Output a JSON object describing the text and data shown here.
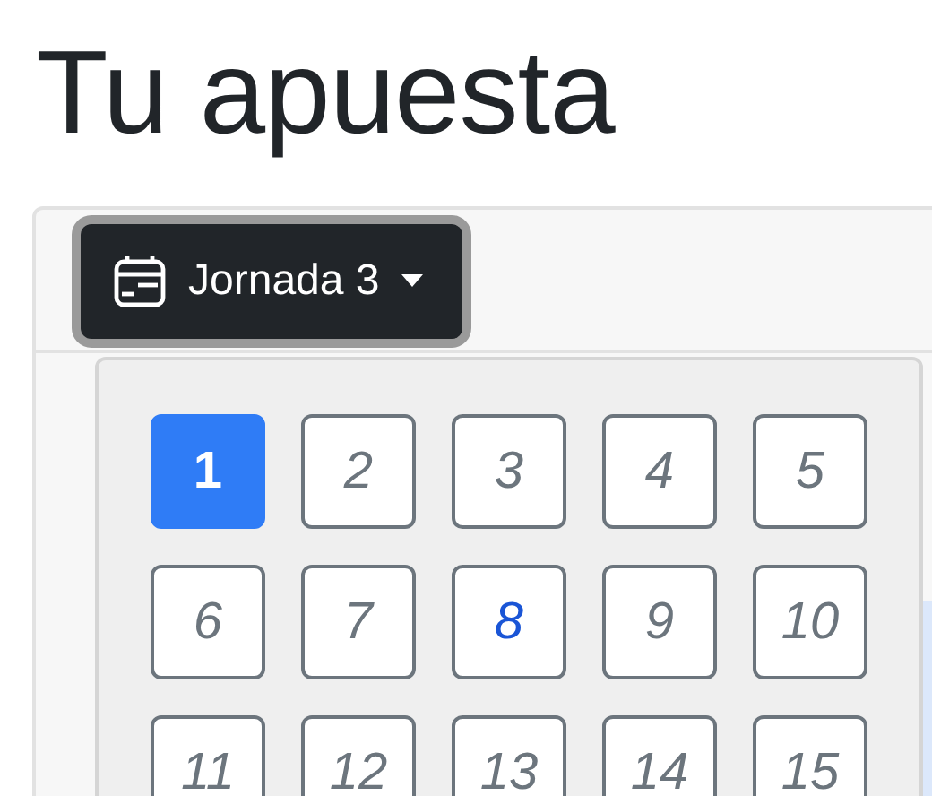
{
  "title": "Tu apuesta",
  "round_button": {
    "label": "Jornada 3",
    "focused": true
  },
  "round_menu": {
    "items": [
      {
        "label": "1",
        "selected": true,
        "current": false
      },
      {
        "label": "2",
        "selected": false,
        "current": false
      },
      {
        "label": "3",
        "selected": false,
        "current": false
      },
      {
        "label": "4",
        "selected": false,
        "current": false
      },
      {
        "label": "5",
        "selected": false,
        "current": false
      },
      {
        "label": "6",
        "selected": false,
        "current": false
      },
      {
        "label": "7",
        "selected": false,
        "current": false
      },
      {
        "label": "8",
        "selected": false,
        "current": true
      },
      {
        "label": "9",
        "selected": false,
        "current": false
      },
      {
        "label": "10",
        "selected": false,
        "current": false
      },
      {
        "label": "11",
        "selected": false,
        "current": false
      },
      {
        "label": "12",
        "selected": false,
        "current": false
      },
      {
        "label": "13",
        "selected": false,
        "current": false
      },
      {
        "label": "14",
        "selected": false,
        "current": false
      },
      {
        "label": "15",
        "selected": false,
        "current": false
      }
    ]
  }
}
